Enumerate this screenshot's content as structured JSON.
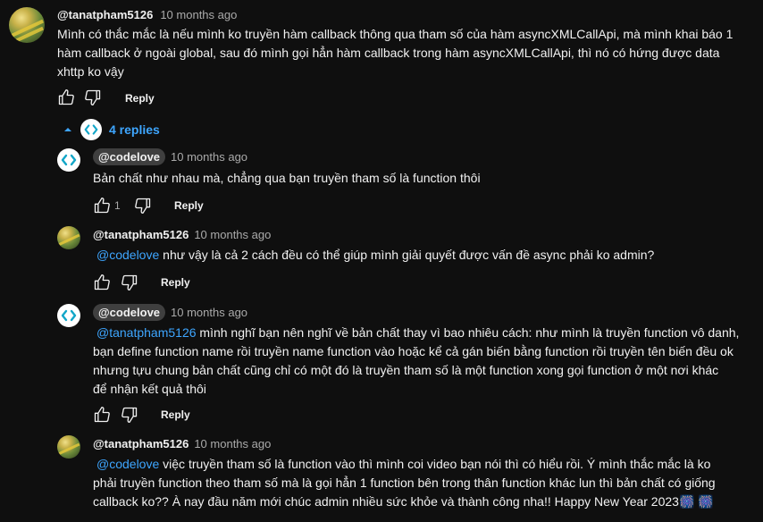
{
  "comments": [
    {
      "author": "@tanatpham5126",
      "time": "10 months ago",
      "text": "Mình có thắc mắc là nếu mình ko truyền hàm callback thông qua tham số của hàm asyncXMLCallApi, mà mình khai báo 1 hàm callback ở ngoài global, sau đó mình gọi hẳn hàm callback trong hàm asyncXMLCallApi,  thì nó có hứng được data xhttp ko vậy",
      "reply_label": "Reply"
    }
  ],
  "replies_toggle": {
    "label": "4 replies"
  },
  "replies": [
    {
      "author": "@codelove",
      "time": "10 months ago",
      "text": "Bản chất như nhau mà, chẳng qua bạn truyền tham số là function thôi",
      "likes": "1",
      "reply_label": "Reply"
    },
    {
      "author": "@tanatpham5126",
      "time": "10 months ago",
      "mention": "@codelove",
      "text": " như vậy là cả 2 cách đều có thể giúp mình giải quyết được vấn đề async phải ko admin?",
      "reply_label": "Reply"
    },
    {
      "author": "@codelove",
      "time": "10 months ago",
      "mention": "@tanatpham5126",
      "text_line1": " mình nghĩ bạn nên nghĩ về bản chất thay vì bao nhiêu cách: như mình là truyền function vô danh,",
      "text_line2": "bạn define function name rồi truyền name function vào hoặc kể cả gán biến bằng function rồi truyền tên biến đều ok",
      "text_line3": "nhưng tựu chung bản chất cũng chỉ có một đó là truyền tham số là một function xong gọi function ở một nơi khác",
      "text_line4": "để nhận kết quả thôi",
      "reply_label": "Reply"
    },
    {
      "author": "@tanatpham5126",
      "time": "10 months ago",
      "mention": "@codelove",
      "text_line1": " việc truyền tham số là function vào thì mình coi video bạn nói thì có hiểu rồi. Ý mình thắc mắc là ko",
      "text_line2": "phải truyền function theo tham số mà là gọi hẳn 1 function bên trong thân function khác lun thì bản chất có giống",
      "text_line3": "callback ko?? À nay đầu năm mới chúc admin nhiều sức khỏe và thành công nha!! Happy New Year 2023",
      "emoji": "🎆 🎆"
    }
  ],
  "icons": {
    "like": "thumb-up-icon",
    "dislike": "thumb-down-icon",
    "collapse": "caret-up-icon",
    "channel_logo": "codelove-logo"
  },
  "colors": {
    "link": "#3ea6ff",
    "background": "#0f0f0f",
    "chip": "#3f3f3f"
  }
}
